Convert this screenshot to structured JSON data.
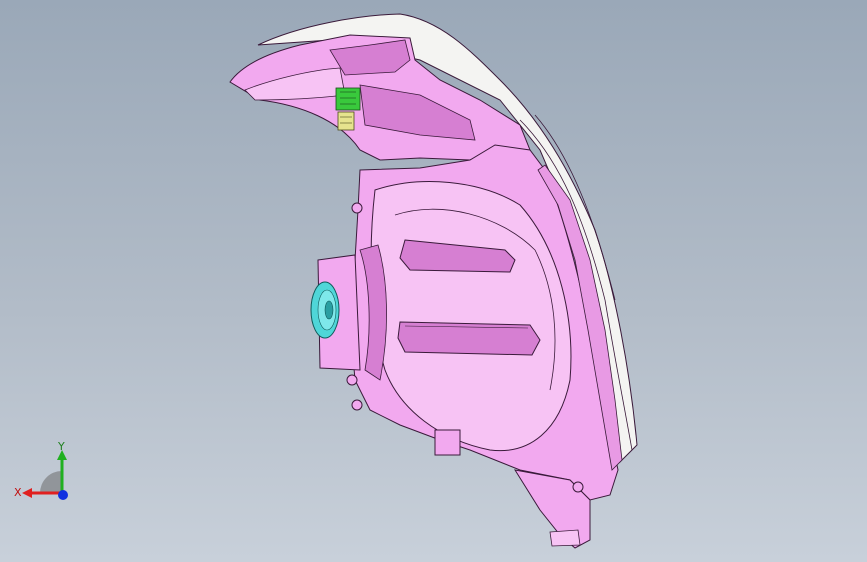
{
  "colors": {
    "housing_fill": "#f2a9ef",
    "housing_fill_light": "#f7c3f4",
    "housing_shade": "#d67fd2",
    "edge": "#3a1a3a",
    "lens": "#f4f4f2",
    "bulb_ring": "#4fd6d8",
    "green_part": "#39c93c",
    "yellow_part": "#e6e38e",
    "axis_x": "#e02020",
    "axis_y": "#20b020",
    "axis_z": "#1030e0"
  },
  "triad": {
    "x_label": "X",
    "y_label": "Y",
    "icon": "coordinate-triad-icon"
  }
}
